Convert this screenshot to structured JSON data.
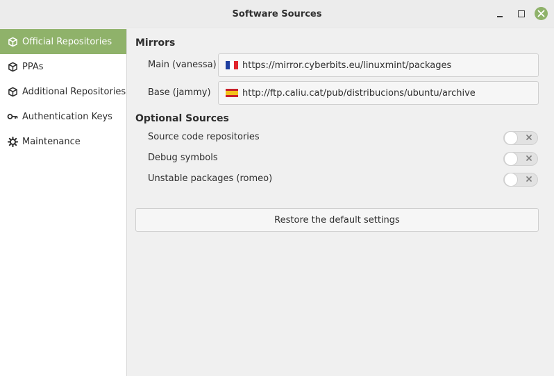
{
  "window": {
    "title": "Software Sources",
    "accent_color": "#8fb26a"
  },
  "sidebar": {
    "items": [
      {
        "label": "Official Repositories",
        "icon": "package-icon",
        "selected": true
      },
      {
        "label": "PPAs",
        "icon": "package-icon",
        "selected": false
      },
      {
        "label": "Additional Repositories",
        "icon": "package-icon",
        "selected": false
      },
      {
        "label": "Authentication Keys",
        "icon": "key-icon",
        "selected": false
      },
      {
        "label": "Maintenance",
        "icon": "gear-icon",
        "selected": false
      }
    ]
  },
  "mirrors": {
    "title": "Mirrors",
    "main_label": "Main (vanessa)",
    "main_url": "https://mirror.cyberbits.eu/linuxmint/packages",
    "main_flag": "flag-france-icon",
    "base_label": "Base (jammy)",
    "base_url": "http://ftp.caliu.cat/pub/distribucions/ubuntu/archive",
    "base_flag": "flag-spain-icon"
  },
  "optional": {
    "title": "Optional Sources",
    "items": [
      {
        "label": "Source code repositories",
        "enabled": false
      },
      {
        "label": "Debug symbols",
        "enabled": false
      },
      {
        "label": "Unstable packages (romeo)",
        "enabled": false
      }
    ]
  },
  "restore_label": "Restore the default settings"
}
